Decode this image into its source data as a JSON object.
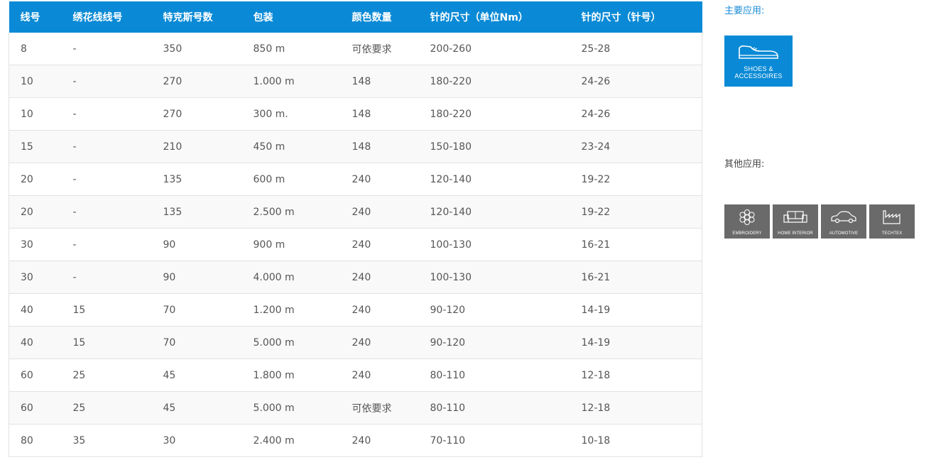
{
  "table": {
    "headers": [
      "线号",
      "绣花线线号",
      "特克斯号数",
      "包装",
      "颜色数量",
      "针的尺寸（单位Nm）",
      "针的尺寸（针号）"
    ],
    "rows": [
      [
        "8",
        "-",
        "350",
        "850 m",
        "可依要求",
        "200-260",
        "25-28"
      ],
      [
        "10",
        "-",
        "270",
        "1.000 m",
        "148",
        "180-220",
        "24-26"
      ],
      [
        "10",
        "-",
        "270",
        "300 m.",
        "148",
        "180-220",
        "24-26"
      ],
      [
        "15",
        "-",
        "210",
        "450 m",
        "148",
        "150-180",
        "23-24"
      ],
      [
        "20",
        "-",
        "135",
        "600 m",
        "240",
        "120-140",
        "19-22"
      ],
      [
        "20",
        "-",
        "135",
        "2.500 m",
        "240",
        "120-140",
        "19-22"
      ],
      [
        "30",
        "-",
        "90",
        "900 m",
        "240",
        "100-130",
        "16-21"
      ],
      [
        "30",
        "-",
        "90",
        "4.000 m",
        "240",
        "100-130",
        "16-21"
      ],
      [
        "40",
        "15",
        "70",
        "1.200 m",
        "240",
        "90-120",
        "14-19"
      ],
      [
        "40",
        "15",
        "70",
        "5.000 m",
        "240",
        "90-120",
        "14-19"
      ],
      [
        "60",
        "25",
        "45",
        "1.800 m",
        "240",
        "80-110",
        "12-18"
      ],
      [
        "60",
        "25",
        "45",
        "5.000 m",
        "可依要求",
        "80-110",
        "12-18"
      ],
      [
        "80",
        "35",
        "30",
        "2.400 m",
        "240",
        "70-110",
        "10-18"
      ]
    ]
  },
  "sidebar": {
    "main_label": "主要应用:",
    "other_label": "其他应用:",
    "main_app": {
      "line1": "SHOES &",
      "line2": "ACCESSOIRES",
      "icon": "shoe-icon"
    },
    "other_apps": [
      {
        "label": "EMBROIDERY",
        "icon": "flower-icon"
      },
      {
        "label": "HOME INTERIOR",
        "icon": "sofa-icon"
      },
      {
        "label": "AUTOMOTIVE",
        "icon": "car-icon"
      },
      {
        "label": "TECHTEX",
        "icon": "factory-icon"
      }
    ]
  },
  "colors": {
    "accent": "#0a8ad6",
    "tile_gray": "#6a6a6a"
  }
}
